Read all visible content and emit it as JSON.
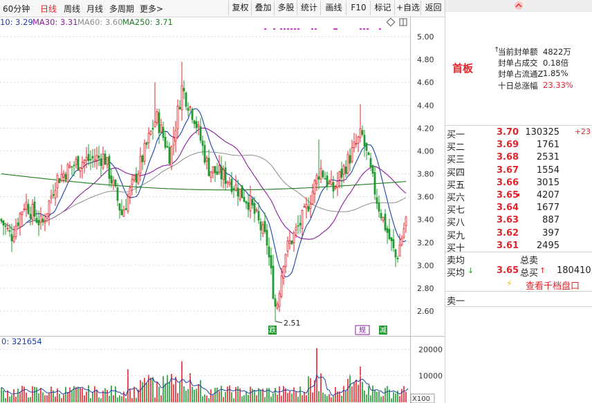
{
  "toolbar": {
    "tabs": [
      "60分钟",
      "日线",
      "周线",
      "月线",
      "多周期",
      "更多"
    ],
    "active_tab": "日线",
    "more_chevron": ">",
    "buttons": [
      "复权",
      "叠加",
      "多股",
      "统计",
      "画线",
      "F10",
      "标记",
      "+自选",
      "返回"
    ]
  },
  "ma_legend": {
    "ma10": "10: 3.29",
    "ma30": "MA30: 3.31",
    "ma60": "MA60: 3.60",
    "ma250": "MA250: 3.71"
  },
  "volume_legend": "0: 321654",
  "markers": {
    "low_label": "2.51",
    "tag_left": "跌",
    "tag_mid": "规",
    "tag_right": "减"
  },
  "colors": {
    "up": "#e0242b",
    "down": "#1f9a2e",
    "ma10": "#1b3fa8",
    "ma30": "#8a1a9e",
    "ma60": "#8c8c8c",
    "ma250": "#1d7a1d",
    "accent_red": "#e0242b"
  },
  "right_panel": {
    "badge": "首板",
    "stats": [
      {
        "label": "当前封单额",
        "value": "4822万",
        "value_color": "#222"
      },
      {
        "label": "封单占成交",
        "value": "0.18倍",
        "value_color": "#222"
      },
      {
        "label": "封单占流通Z",
        "value": "1.85%",
        "value_color": "#222"
      },
      {
        "label": "十日总涨幅",
        "value": "23.33%",
        "value_color": "#e0242b"
      }
    ],
    "order_book": [
      {
        "label": "买一",
        "price": "3.70",
        "volume": "130325",
        "extra": "+23"
      },
      {
        "label": "买二",
        "price": "3.69",
        "volume": "1761",
        "extra": ""
      },
      {
        "label": "买三",
        "price": "3.68",
        "volume": "2531",
        "extra": ""
      },
      {
        "label": "买四",
        "price": "3.67",
        "volume": "1554",
        "extra": ""
      },
      {
        "label": "买五",
        "price": "3.66",
        "volume": "3015",
        "extra": ""
      },
      {
        "label": "买六",
        "price": "3.65",
        "volume": "4207",
        "extra": ""
      },
      {
        "label": "买七",
        "price": "3.64",
        "volume": "1677",
        "extra": ""
      },
      {
        "label": "买八",
        "price": "3.63",
        "volume": "887",
        "extra": ""
      },
      {
        "label": "买九",
        "price": "3.62",
        "volume": "397",
        "extra": ""
      },
      {
        "label": "买十",
        "price": "3.61",
        "volume": "2495",
        "extra": ""
      }
    ],
    "avg_sell_label": "卖均",
    "total_sell_label": "总卖",
    "avg_buy_label": "买均",
    "avg_buy_price": "3.65",
    "total_buy_label": "总买",
    "total_buy_value": "180410",
    "view_ten_levels": "查看千档盘口",
    "sell_one_label": "卖一"
  },
  "chart_data": [
    {
      "type": "candlestick",
      "y_ticks": [
        "5.00",
        "4.80",
        "4.60",
        "4.40",
        "4.20",
        "4.00",
        "3.80",
        "3.60",
        "3.40",
        "3.20",
        "3.00",
        "2.80",
        "2.60"
      ],
      "ylim": [
        2.5,
        5.05
      ],
      "grid": "horizontal dotted",
      "key_points": [
        {
          "x": 0,
          "y": 3.4
        },
        {
          "x": 15,
          "y": 3.25
        },
        {
          "x": 35,
          "y": 3.55
        },
        {
          "x": 60,
          "y": 3.35
        },
        {
          "x": 80,
          "y": 3.75
        },
        {
          "x": 110,
          "y": 3.9
        },
        {
          "x": 150,
          "y": 3.95
        },
        {
          "x": 175,
          "y": 3.45
        },
        {
          "x": 200,
          "y": 3.85
        },
        {
          "x": 225,
          "y": 4.3
        },
        {
          "x": 245,
          "y": 3.95
        },
        {
          "x": 262,
          "y": 4.55
        },
        {
          "x": 280,
          "y": 4.3
        },
        {
          "x": 300,
          "y": 3.85
        },
        {
          "x": 330,
          "y": 3.75
        },
        {
          "x": 360,
          "y": 3.55
        },
        {
          "x": 385,
          "y": 3.2
        },
        {
          "x": 398,
          "y": 2.6
        },
        {
          "x": 410,
          "y": 3.1
        },
        {
          "x": 440,
          "y": 3.45
        },
        {
          "x": 462,
          "y": 3.85
        },
        {
          "x": 480,
          "y": 3.65
        },
        {
          "x": 505,
          "y": 3.95
        },
        {
          "x": 522,
          "y": 4.15
        },
        {
          "x": 545,
          "y": 3.55
        },
        {
          "x": 572,
          "y": 3.05
        },
        {
          "x": 588,
          "y": 3.45
        }
      ],
      "low_point": {
        "x": 398,
        "y": 2.51
      }
    },
    {
      "type": "bar",
      "name": "volume",
      "y_ticks": [
        "20000",
        "10000"
      ],
      "unit": "X100",
      "ylim": [
        0,
        23000
      ]
    }
  ]
}
